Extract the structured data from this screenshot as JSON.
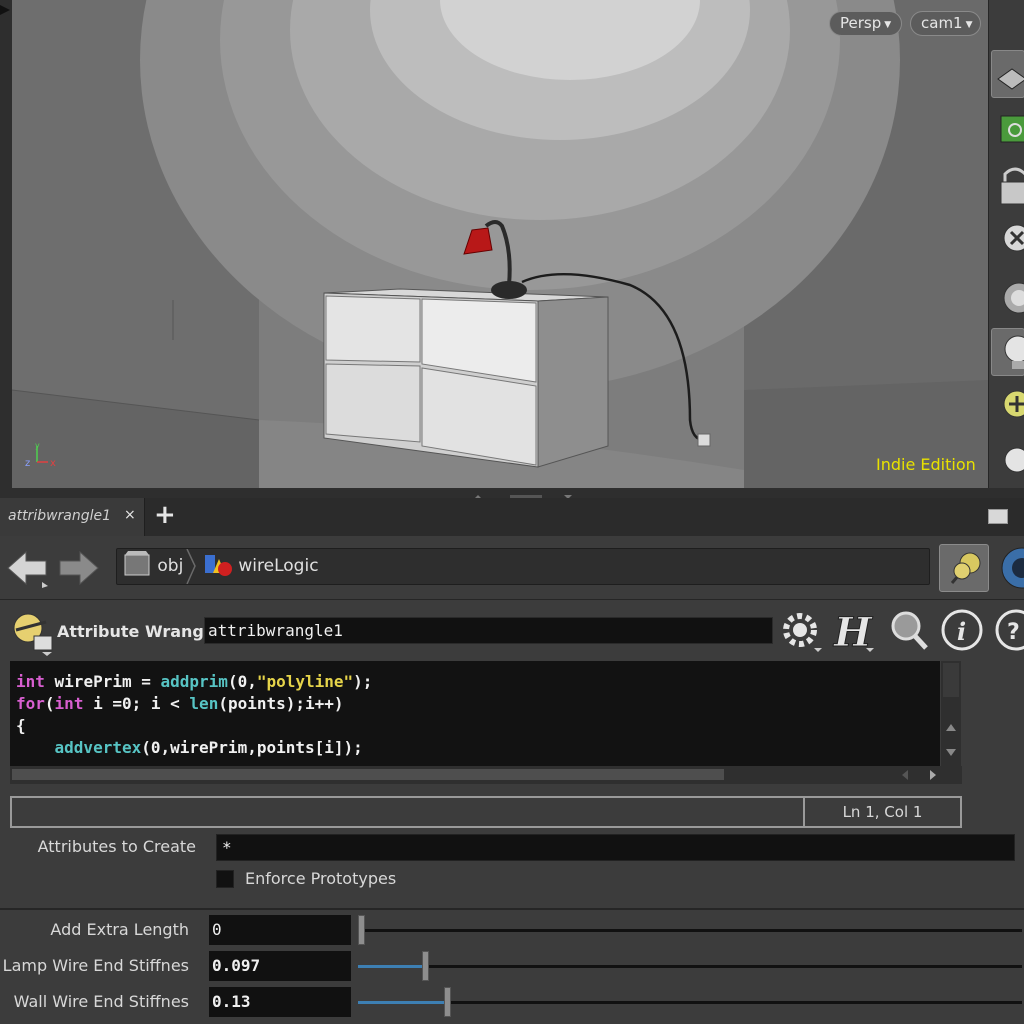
{
  "viewport": {
    "view_mode": "Persp",
    "camera": "cam1",
    "edition": "Indie Edition",
    "axis_labels": {
      "y": "y",
      "z": "z",
      "x": "x"
    }
  },
  "shelf": {
    "icons": [
      "display-options-icon",
      "snapping-icon",
      "lock-icon",
      "light-off-icon",
      "camera-icon",
      "light-icon",
      "add-light-icon",
      "headlight-icon"
    ]
  },
  "tab": {
    "label": "attribwrangle1",
    "close": "×",
    "add": "+"
  },
  "path": {
    "items": [
      {
        "label": "obj",
        "icon": "obj-context-icon"
      },
      {
        "label": "wireLogic",
        "icon": "geometry-node-icon"
      }
    ],
    "dropdown": "▼"
  },
  "node": {
    "type_label": "Attribute Wrangle",
    "name": "attribwrangle1"
  },
  "code": {
    "lines": [
      [
        {
          "t": "int",
          "c": "kw"
        },
        {
          "t": " wirePrim = ",
          "c": "pl"
        },
        {
          "t": "addprim",
          "c": "fn"
        },
        {
          "t": "(0,",
          "c": "pl"
        },
        {
          "t": "\"polyline\"",
          "c": "str"
        },
        {
          "t": ");",
          "c": "pl"
        }
      ],
      [
        {
          "t": "for",
          "c": "kw"
        },
        {
          "t": "(",
          "c": "pl"
        },
        {
          "t": "int",
          "c": "kw"
        },
        {
          "t": " i =0; i < ",
          "c": "pl"
        },
        {
          "t": "len",
          "c": "fn"
        },
        {
          "t": "(points);i++)",
          "c": "pl"
        }
      ],
      [
        {
          "t": "{",
          "c": "pl"
        }
      ],
      [
        {
          "t": "    ",
          "c": "pl"
        },
        {
          "t": "addvertex",
          "c": "fn"
        },
        {
          "t": "(0,wirePrim,points[i]);",
          "c": "pl"
        }
      ]
    ]
  },
  "status": {
    "position": "Ln 1, Col 1"
  },
  "attributes": {
    "create_label": "Attributes to Create",
    "create_value": "*",
    "enforce_label": "Enforce Prototypes",
    "enforce_checked": false
  },
  "params": [
    {
      "label": "Add Extra Length",
      "value": "0",
      "fraction": 0.0,
      "bold": false
    },
    {
      "label": "Lamp Wire End Stiffnes",
      "value": "0.097",
      "fraction": 0.097,
      "bold": true
    },
    {
      "label": "Wall Wire End Stiffnes",
      "value": "0.13",
      "fraction": 0.13,
      "bold": true
    }
  ],
  "colors": {
    "edition": "#e8e100",
    "keyword": "#d85fd0",
    "function": "#57c4c4",
    "string": "#e6d44a",
    "slider_fill": "#3d7fb3"
  }
}
